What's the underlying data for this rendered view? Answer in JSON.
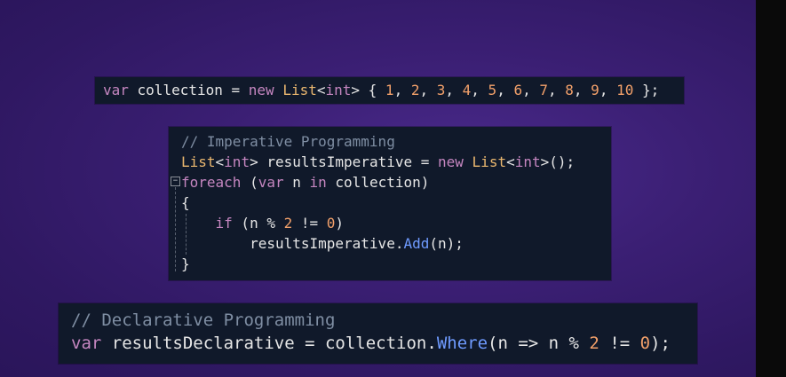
{
  "snippet_top": {
    "tokens": [
      {
        "t": "var",
        "c": "kw"
      },
      {
        "t": " collection = ",
        "c": "op"
      },
      {
        "t": "new",
        "c": "kw"
      },
      {
        "t": " ",
        "c": "op"
      },
      {
        "t": "List",
        "c": "ty"
      },
      {
        "t": "<",
        "c": "op"
      },
      {
        "t": "int",
        "c": "kw"
      },
      {
        "t": "> { ",
        "c": "op"
      },
      {
        "t": "1",
        "c": "num"
      },
      {
        "t": ", ",
        "c": "op"
      },
      {
        "t": "2",
        "c": "num"
      },
      {
        "t": ", ",
        "c": "op"
      },
      {
        "t": "3",
        "c": "num"
      },
      {
        "t": ", ",
        "c": "op"
      },
      {
        "t": "4",
        "c": "num"
      },
      {
        "t": ", ",
        "c": "op"
      },
      {
        "t": "5",
        "c": "num"
      },
      {
        "t": ", ",
        "c": "op"
      },
      {
        "t": "6",
        "c": "num"
      },
      {
        "t": ", ",
        "c": "op"
      },
      {
        "t": "7",
        "c": "num"
      },
      {
        "t": ", ",
        "c": "op"
      },
      {
        "t": "8",
        "c": "num"
      },
      {
        "t": ", ",
        "c": "op"
      },
      {
        "t": "9",
        "c": "num"
      },
      {
        "t": ", ",
        "c": "op"
      },
      {
        "t": "10",
        "c": "num"
      },
      {
        "t": " };",
        "c": "op"
      }
    ]
  },
  "snippet_imperative": {
    "lines": [
      [
        {
          "t": "// Imperative Programming",
          "c": "cm"
        }
      ],
      [
        {
          "t": "List",
          "c": "ty"
        },
        {
          "t": "<",
          "c": "op"
        },
        {
          "t": "int",
          "c": "kw"
        },
        {
          "t": "> resultsImperative = ",
          "c": "op"
        },
        {
          "t": "new",
          "c": "kw"
        },
        {
          "t": " ",
          "c": "op"
        },
        {
          "t": "List",
          "c": "ty"
        },
        {
          "t": "<",
          "c": "op"
        },
        {
          "t": "int",
          "c": "kw"
        },
        {
          "t": ">();",
          "c": "op"
        }
      ],
      [
        {
          "t": "foreach",
          "c": "kw"
        },
        {
          "t": " (",
          "c": "op"
        },
        {
          "t": "var",
          "c": "kw"
        },
        {
          "t": " n ",
          "c": "op"
        },
        {
          "t": "in",
          "c": "kw"
        },
        {
          "t": " collection)",
          "c": "op"
        }
      ],
      [
        {
          "t": "{",
          "c": "op"
        }
      ],
      [
        {
          "t": "    ",
          "c": "op"
        },
        {
          "t": "if",
          "c": "kw"
        },
        {
          "t": " (n % ",
          "c": "op"
        },
        {
          "t": "2",
          "c": "num"
        },
        {
          "t": " != ",
          "c": "op"
        },
        {
          "t": "0",
          "c": "num"
        },
        {
          "t": ")",
          "c": "op"
        }
      ],
      [
        {
          "t": "        resultsImperative.",
          "c": "op"
        },
        {
          "t": "Add",
          "c": "fn"
        },
        {
          "t": "(n);",
          "c": "op"
        }
      ],
      [
        {
          "t": "}",
          "c": "op"
        }
      ]
    ],
    "fold_glyph": "−"
  },
  "snippet_declarative": {
    "lines": [
      [
        {
          "t": "// Declarative Programming",
          "c": "cm"
        }
      ],
      [
        {
          "t": "var",
          "c": "kw"
        },
        {
          "t": " resultsDeclarative = collection.",
          "c": "op"
        },
        {
          "t": "Where",
          "c": "fn"
        },
        {
          "t": "(n => n % ",
          "c": "op"
        },
        {
          "t": "2",
          "c": "num"
        },
        {
          "t": " != ",
          "c": "op"
        },
        {
          "t": "0",
          "c": "num"
        },
        {
          "t": ");",
          "c": "op"
        }
      ]
    ]
  }
}
